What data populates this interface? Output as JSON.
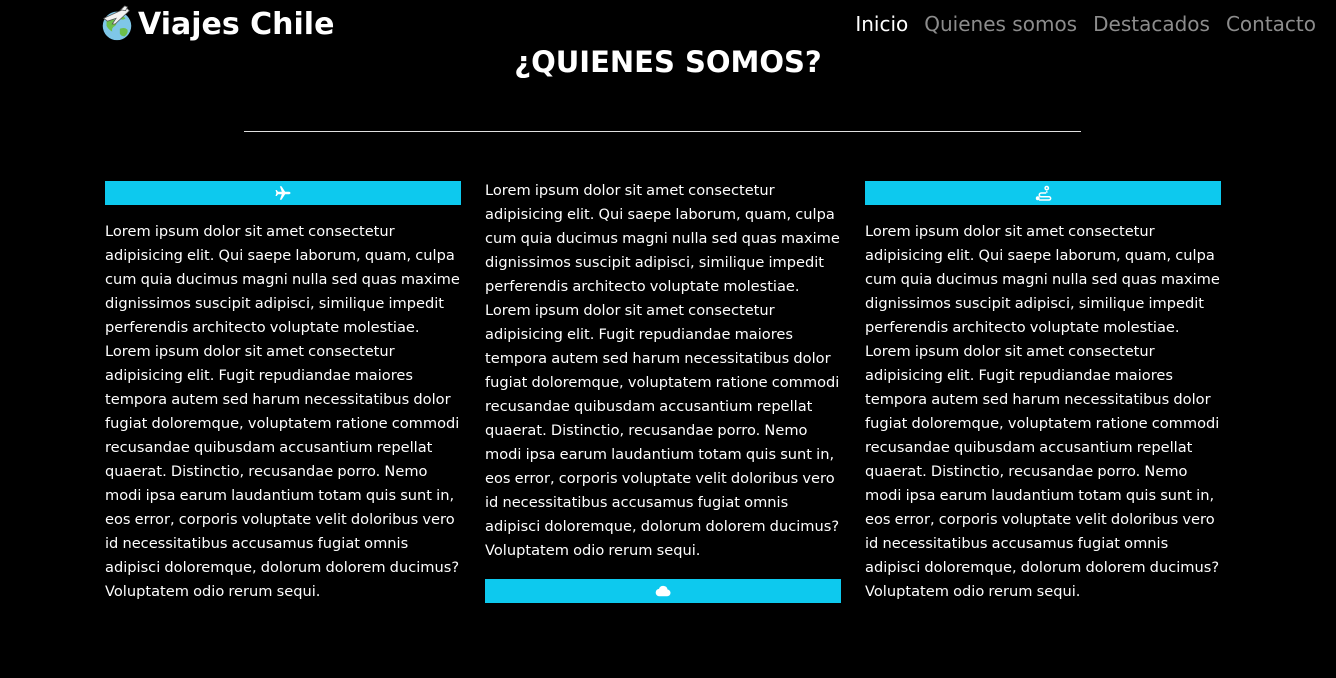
{
  "brand": {
    "name": "Viajes Chile",
    "logo_icon": "globe-plane-logo-icon"
  },
  "nav": {
    "items": [
      {
        "label": "Inicio",
        "active": true
      },
      {
        "label": "Quienes somos",
        "active": false
      },
      {
        "label": "Destacados",
        "active": false
      },
      {
        "label": "Contacto",
        "active": false
      }
    ]
  },
  "section": {
    "title": "¿QUIENES SOMOS?"
  },
  "colors": {
    "background": "#000000",
    "accent": "#0dc9ee",
    "nav_inactive": "#8c8c8c",
    "text": "#ffffff"
  },
  "columns": [
    {
      "icon": "plane-icon",
      "text": "Lorem ipsum dolor sit amet consectetur adipisicing elit. Qui saepe laborum, quam, culpa cum quia ducimus magni nulla sed quas maxime dignissimos suscipit adipisci, similique impedit perferendis architecto voluptate molestiae. Lorem ipsum dolor sit amet consectetur adipisicing elit. Fugit repudiandae maiores tempora autem sed harum necessitatibus dolor fugiat doloremque, voluptatem ratione commodi recusandae quibusdam accusantium repellat quaerat. Distinctio, recusandae porro. Nemo modi ipsa earum laudantium totam quis sunt in, eos error, corporis voluptate velit doloribus vero id necessitatibus accusamus fugiat omnis adipisci doloremque, dolorum dolorem ducimus? Voluptatem odio rerum sequi."
    },
    {
      "icon": "cloud-icon",
      "text": "Lorem ipsum dolor sit amet consectetur adipisicing elit. Qui saepe laborum, quam, culpa cum quia ducimus magni nulla sed quas maxime dignissimos suscipit adipisci, similique impedit perferendis architecto voluptate molestiae. Lorem ipsum dolor sit amet consectetur adipisicing elit. Fugit repudiandae maiores tempora autem sed harum necessitatibus dolor fugiat doloremque, voluptatem ratione commodi recusandae quibusdam accusantium repellat quaerat. Distinctio, recusandae porro. Nemo modi ipsa earum laudantium totam quis sunt in, eos error, corporis voluptate velit doloribus vero id necessitatibus accusamus fugiat omnis adipisci doloremque, dolorum dolorem ducimus? Voluptatem odio rerum sequi."
    },
    {
      "icon": "route-icon",
      "text": "Lorem ipsum dolor sit amet consectetur adipisicing elit. Qui saepe laborum, quam, culpa cum quia ducimus magni nulla sed quas maxime dignissimos suscipit adipisci, similique impedit perferendis architecto voluptate molestiae. Lorem ipsum dolor sit amet consectetur adipisicing elit. Fugit repudiandae maiores tempora autem sed harum necessitatibus dolor fugiat doloremque, voluptatem ratione commodi recusandae quibusdam accusantium repellat quaerat. Distinctio, recusandae porro. Nemo modi ipsa earum laudantium totam quis sunt in, eos error, corporis voluptate velit doloribus vero id necessitatibus accusamus fugiat omnis adipisci doloremque, dolorum dolorem ducimus? Voluptatem odio rerum sequi."
    }
  ]
}
